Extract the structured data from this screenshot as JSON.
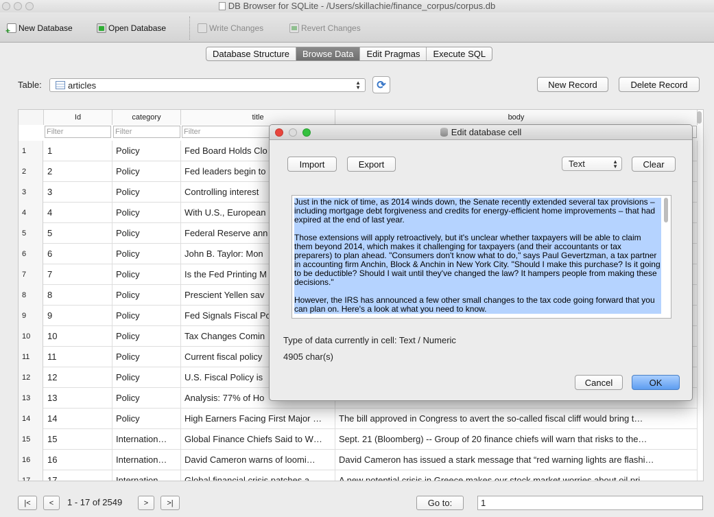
{
  "window": {
    "title": "DB Browser for SQLite - /Users/skillachie/finance_corpus/corpus.db"
  },
  "toolbar": {
    "new_database": "New Database",
    "open_database": "Open Database",
    "write_changes": "Write Changes",
    "revert_changes": "Revert Changes"
  },
  "tabs": [
    {
      "label": "Database Structure",
      "active": false
    },
    {
      "label": "Browse Data",
      "active": true
    },
    {
      "label": "Edit Pragmas",
      "active": false
    },
    {
      "label": "Execute SQL",
      "active": false
    }
  ],
  "browse": {
    "table_label": "Table:",
    "table_value": "articles",
    "new_record": "New Record",
    "delete_record": "Delete Record",
    "columns": [
      "Id",
      "category",
      "title",
      "body"
    ],
    "filter_placeholder": "Filter",
    "rows": [
      {
        "num": "1",
        "id": "1",
        "category": "Policy",
        "title": "Fed Board Holds Clo",
        "body": ""
      },
      {
        "num": "2",
        "id": "2",
        "category": "Policy",
        "title": "Fed leaders begin to",
        "body": ""
      },
      {
        "num": "3",
        "id": "3",
        "category": "Policy",
        "title": "Controlling interest",
        "body": ""
      },
      {
        "num": "4",
        "id": "4",
        "category": "Policy",
        "title": "With U.S., European",
        "body": ""
      },
      {
        "num": "5",
        "id": "5",
        "category": "Policy",
        "title": "Federal Reserve ann",
        "body": ""
      },
      {
        "num": "6",
        "id": "6",
        "category": "Policy",
        "title": "John B. Taylor: Mon",
        "body": ""
      },
      {
        "num": "7",
        "id": "7",
        "category": "Policy",
        "title": "Is the Fed Printing M",
        "body": ""
      },
      {
        "num": "8",
        "id": "8",
        "category": "Policy",
        "title": "Prescient Yellen sav",
        "body": ""
      },
      {
        "num": "9",
        "id": "9",
        "category": "Policy",
        "title": "Fed Signals Fiscal Po",
        "body": ""
      },
      {
        "num": "10",
        "id": "10",
        "category": "Policy",
        "title": "Tax Changes Comin",
        "body": ""
      },
      {
        "num": "11",
        "id": "11",
        "category": "Policy",
        "title": "Current fiscal policy",
        "body": ""
      },
      {
        "num": "12",
        "id": "12",
        "category": "Policy",
        "title": "U.S. Fiscal Policy is",
        "body": ""
      },
      {
        "num": "13",
        "id": "13",
        "category": "Policy",
        "title": "Analysis: 77% of Ho",
        "body": ""
      },
      {
        "num": "14",
        "id": "14",
        "category": "Policy",
        "title": "High Earners Facing First Major …",
        "body": "The bill approved in Congress to avert the so-called fiscal cliff would bring t…"
      },
      {
        "num": "15",
        "id": "15",
        "category": "Internation…",
        "title": "Global Finance Chiefs Said to W…",
        "body": "Sept. 21 (Bloomberg) -- Group of 20 finance chiefs will warn that risks to the…"
      },
      {
        "num": "16",
        "id": "16",
        "category": "Internation…",
        "title": "David Cameron warns of loomi…",
        "body": "David Cameron has issued a stark message that “red warning lights are flashi…"
      },
      {
        "num": "17",
        "id": "17",
        "category": "Internation…",
        "title": "Global financial crisis patches a…",
        "body": "A new potential crisis in Greece makes our stock market worries about oil pri…"
      }
    ],
    "pager": {
      "first": "|<",
      "prev": "<",
      "status": "1 - 17 of 2549",
      "next": ">",
      "last": ">|",
      "goto_label": "Go to:",
      "goto_value": "1"
    }
  },
  "dialog": {
    "title": "Edit database cell",
    "import": "Import",
    "export": "Export",
    "mode": "Text",
    "clear": "Clear",
    "paragraphs": [
      "Just in the nick of time, as 2014 winds down, the Senate recently extended several tax provisions – including mortgage debt forgiveness and credits for energy-efficient home improvements – that had expired at the end of last year.",
      "Those extensions will apply retroactively, but it's unclear whether taxpayers will be able to claim them beyond 2014, which makes it challenging for taxpayers (and their accountants or tax preparers) to plan ahead. \"Consumers don't know what to do,\" says Paul Gevertzman, a tax partner in accounting firm Anchin, Block & Anchin in New York City. \"Should I make this purchase? Is it going to be deductible? Should I wait until they've changed the law? It hampers people from making these decisions.\"",
      "However, the IRS has announced a few other small changes to the tax code going forward that you can plan on. Here's a look at what you need to know."
    ],
    "type_info": "Type of data currently in cell: Text / Numeric",
    "char_count": "4905 char(s)",
    "cancel": "Cancel",
    "ok": "OK"
  }
}
